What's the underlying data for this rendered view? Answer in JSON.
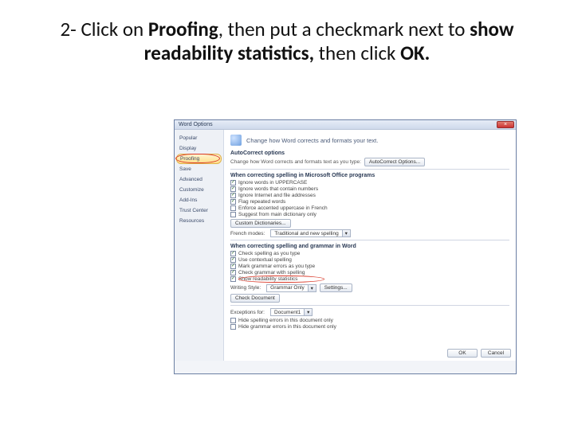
{
  "instruction": {
    "prefix": "2- Click on ",
    "bold1": "Proofing",
    "mid": ", then put a checkmark next to ",
    "bold2": "show readability statistics,",
    "mid2": " then click ",
    "bold3": "OK."
  },
  "dialog": {
    "title": "Word Options",
    "close": "×",
    "sidebar": [
      "Popular",
      "Display",
      "Proofing",
      "Save",
      "Advanced",
      "Customize",
      "Add-Ins",
      "Trust Center",
      "Resources"
    ],
    "header": "Change how Word corrects and formats your text.",
    "autocorrect": {
      "title": "AutoCorrect options",
      "desc": "Change how Word corrects and formats text as you type:",
      "button": "AutoCorrect Options..."
    },
    "section1": {
      "title": "When correcting spelling in Microsoft Office programs",
      "checks": [
        "Ignore words in UPPERCASE",
        "Ignore words that contain numbers",
        "Ignore Internet and file addresses",
        "Flag repeated words",
        "Enforce accented uppercase in French"
      ],
      "suggest": "Suggest from main dictionary only",
      "dict_btn": "Custom Dictionaries...",
      "modes_label": "French modes:",
      "modes_value": "Traditional and new spelling"
    },
    "section2": {
      "title": "When correcting spelling and grammar in Word",
      "checks": [
        "Check spelling as you type",
        "Use contextual spelling",
        "Mark grammar errors as you type",
        "Check grammar with spelling",
        "Show readability statistics"
      ],
      "style_label": "Writing Style:",
      "style_value": "Grammar Only",
      "settings_btn": "Settings...",
      "check_btn": "Check Document"
    },
    "exceptions": {
      "label": "Exceptions for:",
      "doc": "Document1",
      "checks": [
        "Hide spelling errors in this document only",
        "Hide grammar errors in this document only"
      ]
    },
    "ok": "OK",
    "cancel": "Cancel"
  }
}
